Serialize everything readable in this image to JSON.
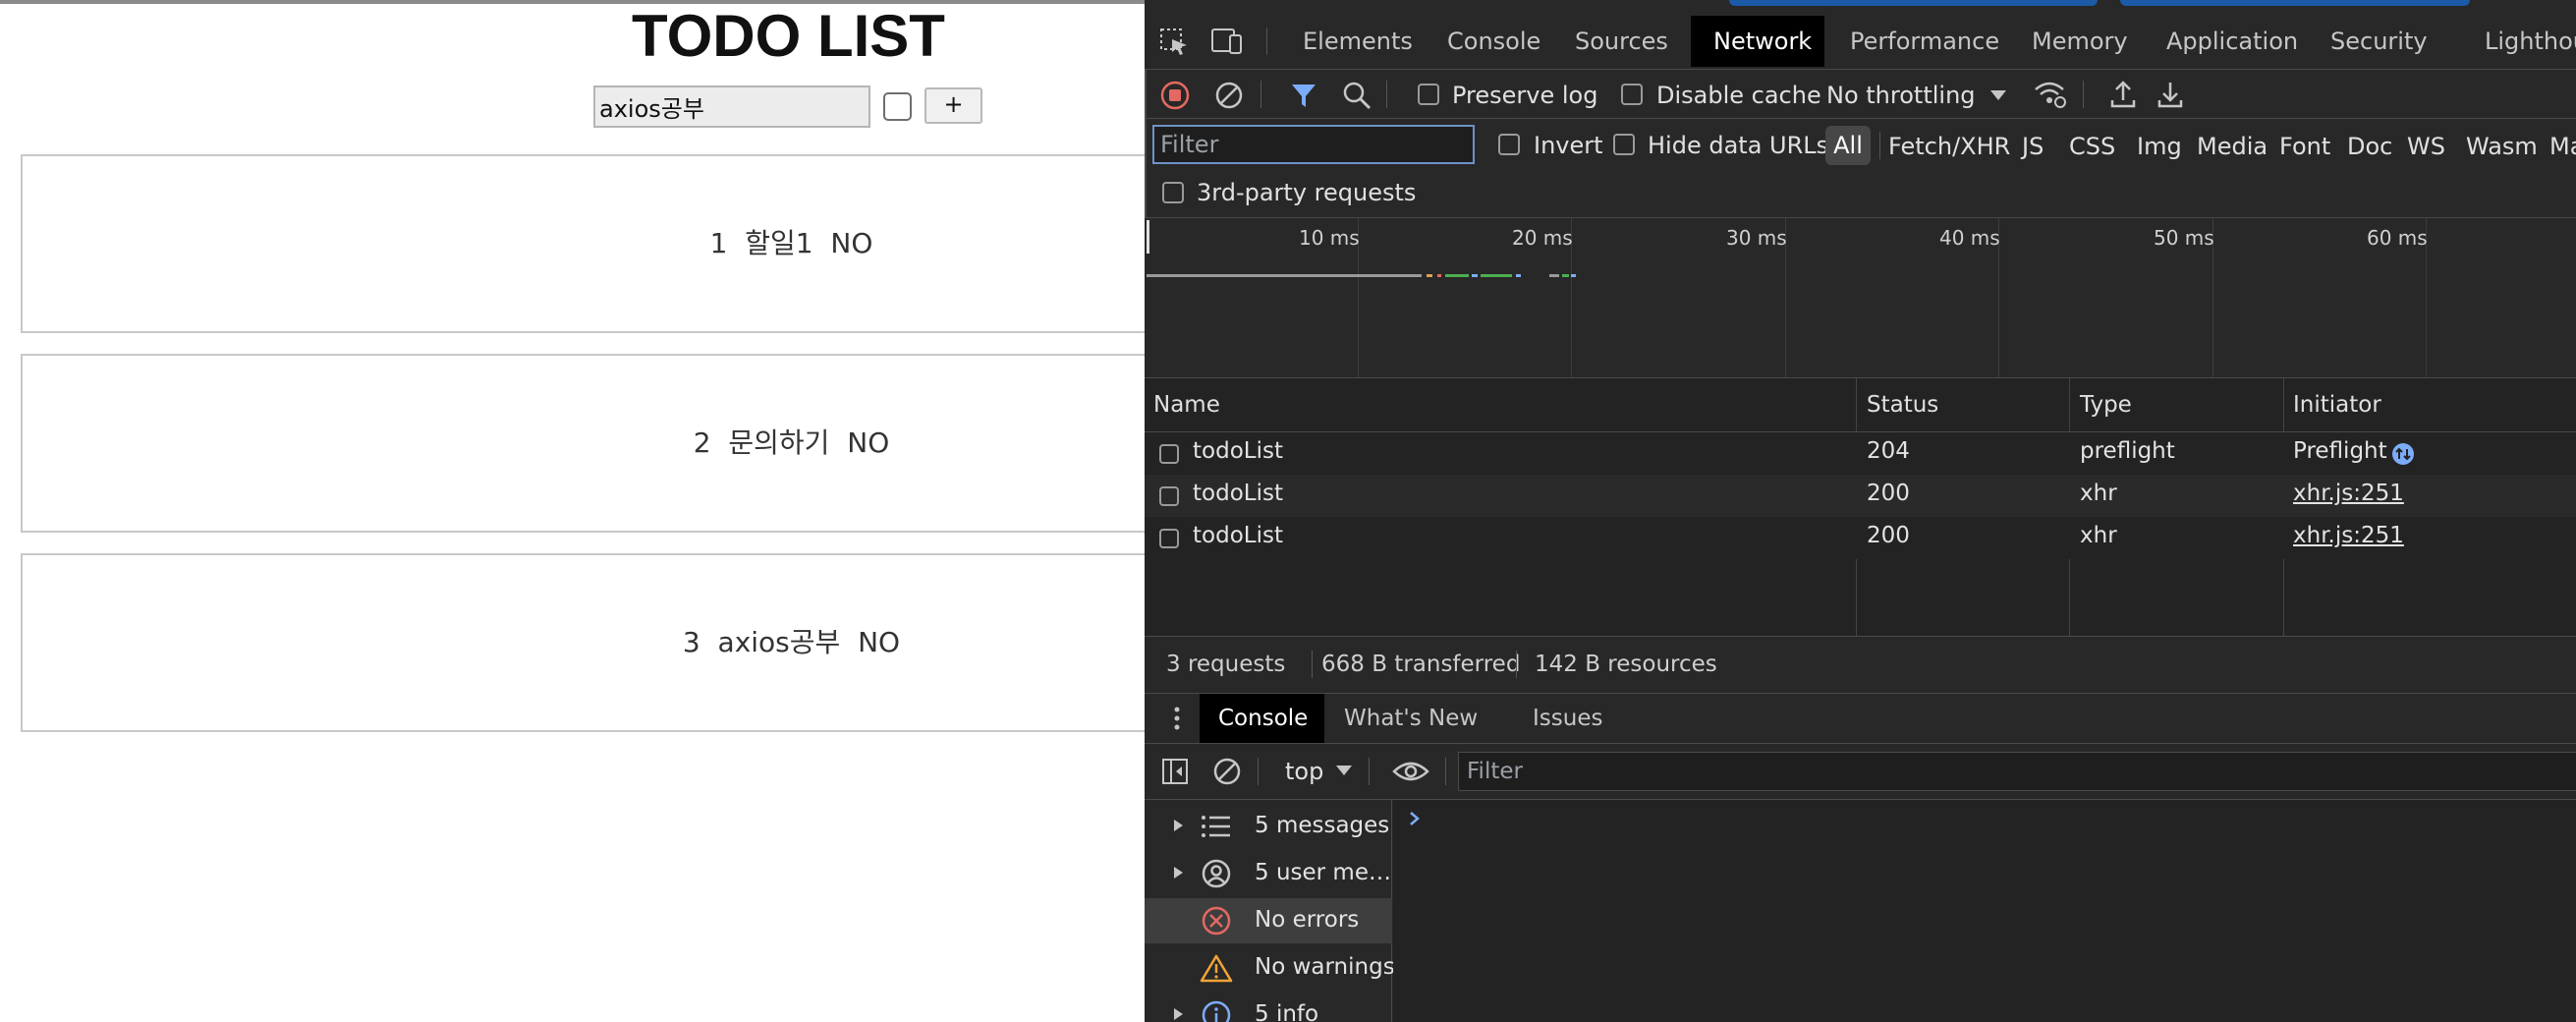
{
  "app": {
    "title": "TODO LIST",
    "input_value": "axios공부",
    "add_label": "+",
    "todos": [
      {
        "id": "1",
        "text": "할일1",
        "done": "NO"
      },
      {
        "id": "2",
        "text": "문의하기",
        "done": "NO"
      },
      {
        "id": "3",
        "text": "axios공부",
        "done": "NO"
      }
    ]
  },
  "devtools": {
    "tabs": [
      "Elements",
      "Console",
      "Sources",
      "Network",
      "Performance",
      "Memory",
      "Application",
      "Security",
      "Lighthou"
    ],
    "active_tab": "Network",
    "toolbar": {
      "preserve_log": "Preserve log",
      "disable_cache": "Disable cache",
      "throttling": "No throttling"
    },
    "filter_bar": {
      "placeholder": "Filter",
      "invert": "Invert",
      "hide_data_urls": "Hide data URLs",
      "types": [
        "All",
        "Fetch/XHR",
        "JS",
        "CSS",
        "Img",
        "Media",
        "Font",
        "Doc",
        "WS",
        "Wasm",
        "Ma"
      ],
      "third_party": "3rd-party requests"
    },
    "timeline_ticks": [
      "10 ms",
      "20 ms",
      "30 ms",
      "40 ms",
      "50 ms",
      "60 ms"
    ],
    "table": {
      "headers": [
        "Name",
        "Status",
        "Type",
        "Initiator"
      ],
      "rows": [
        {
          "name": "todoList",
          "status": "204",
          "type": "preflight",
          "initiator": "Preflight"
        },
        {
          "name": "todoList",
          "status": "200",
          "type": "xhr",
          "initiator": "xhr.js:251"
        },
        {
          "name": "todoList",
          "status": "200",
          "type": "xhr",
          "initiator": "xhr.js:251"
        }
      ]
    },
    "summary": {
      "requests": "3 requests",
      "transferred": "668 B transferred",
      "resources": "142 B resources"
    },
    "drawer": {
      "tabs": [
        "Console",
        "What's New",
        "Issues"
      ],
      "context": "top",
      "filter_placeholder": "Filter",
      "sidebar": [
        "5 messages",
        "5 user me…",
        "No errors",
        "No warnings",
        "5 info"
      ]
    },
    "colors": {
      "accent": "#1b5aa6",
      "error": "#e46962",
      "warning": "#f2a33a",
      "info": "#7cacf8"
    }
  }
}
